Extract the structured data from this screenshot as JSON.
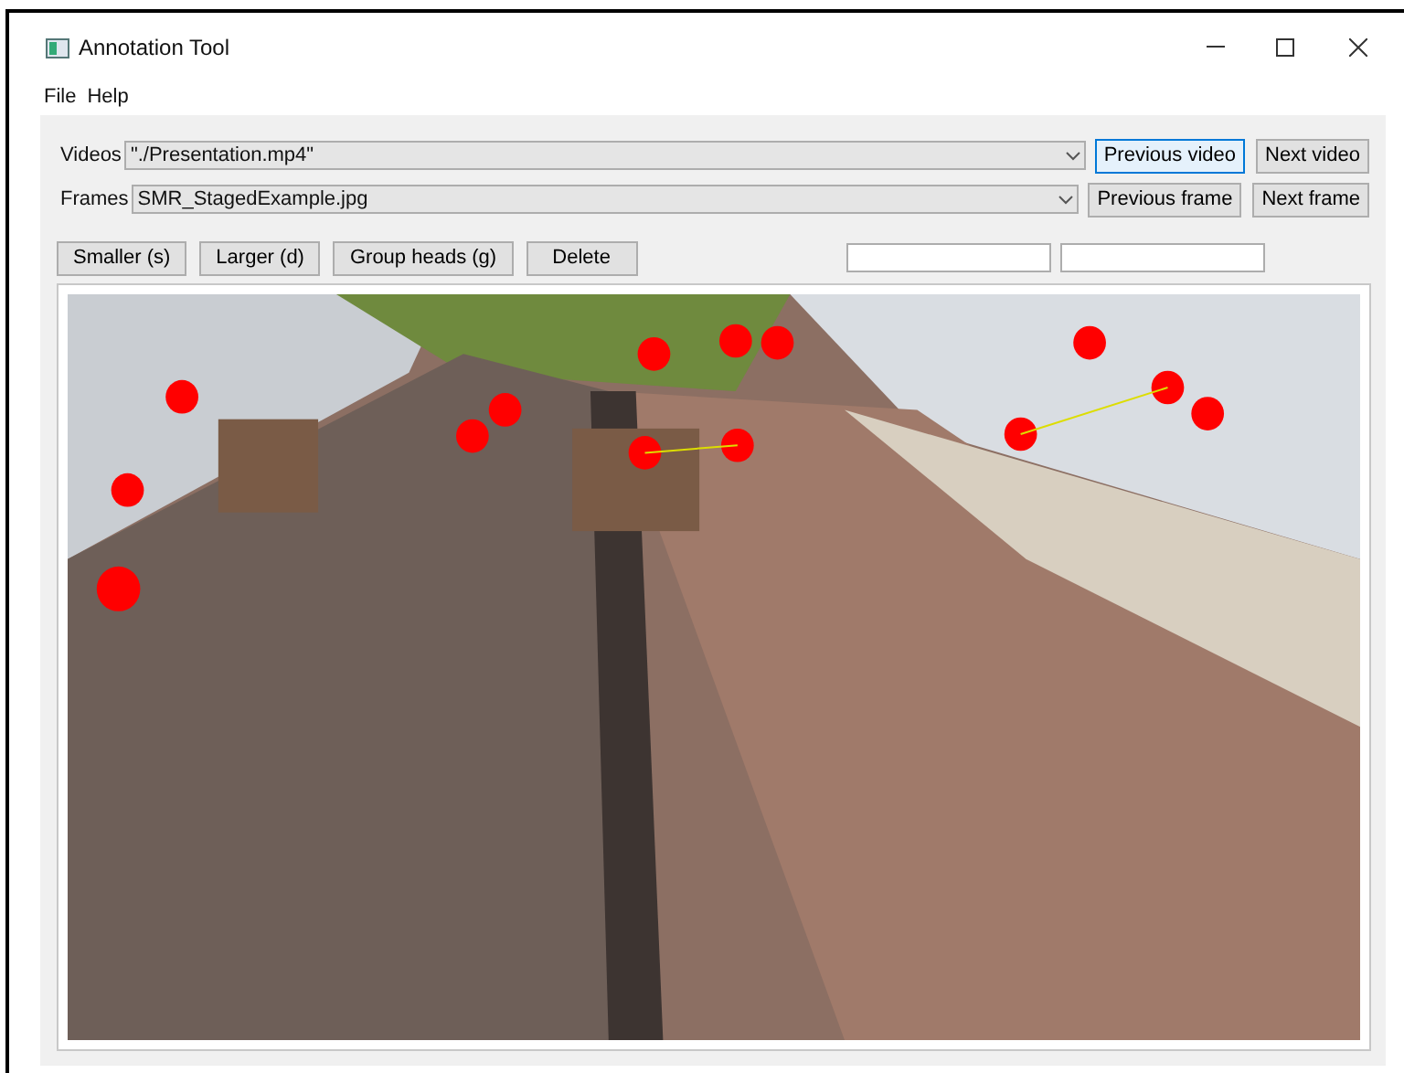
{
  "window": {
    "title": "Annotation Tool"
  },
  "menu": [
    "File",
    "Help"
  ],
  "rows": [
    {
      "label": "Videos",
      "value": "\"./Presentation.mp4\"",
      "buttons": [
        {
          "label": "Previous video",
          "focused": true
        },
        {
          "label": "Next video",
          "focused": false
        }
      ]
    },
    {
      "label": "Frames",
      "value": "SMR_StagedExample.jpg",
      "buttons": [
        {
          "label": "Previous frame",
          "focused": false
        },
        {
          "label": "Next frame",
          "focused": false
        }
      ]
    }
  ],
  "tools": [
    "Smaller (s)",
    "Larger (d)",
    "Group heads (g)",
    "Delete"
  ]
}
